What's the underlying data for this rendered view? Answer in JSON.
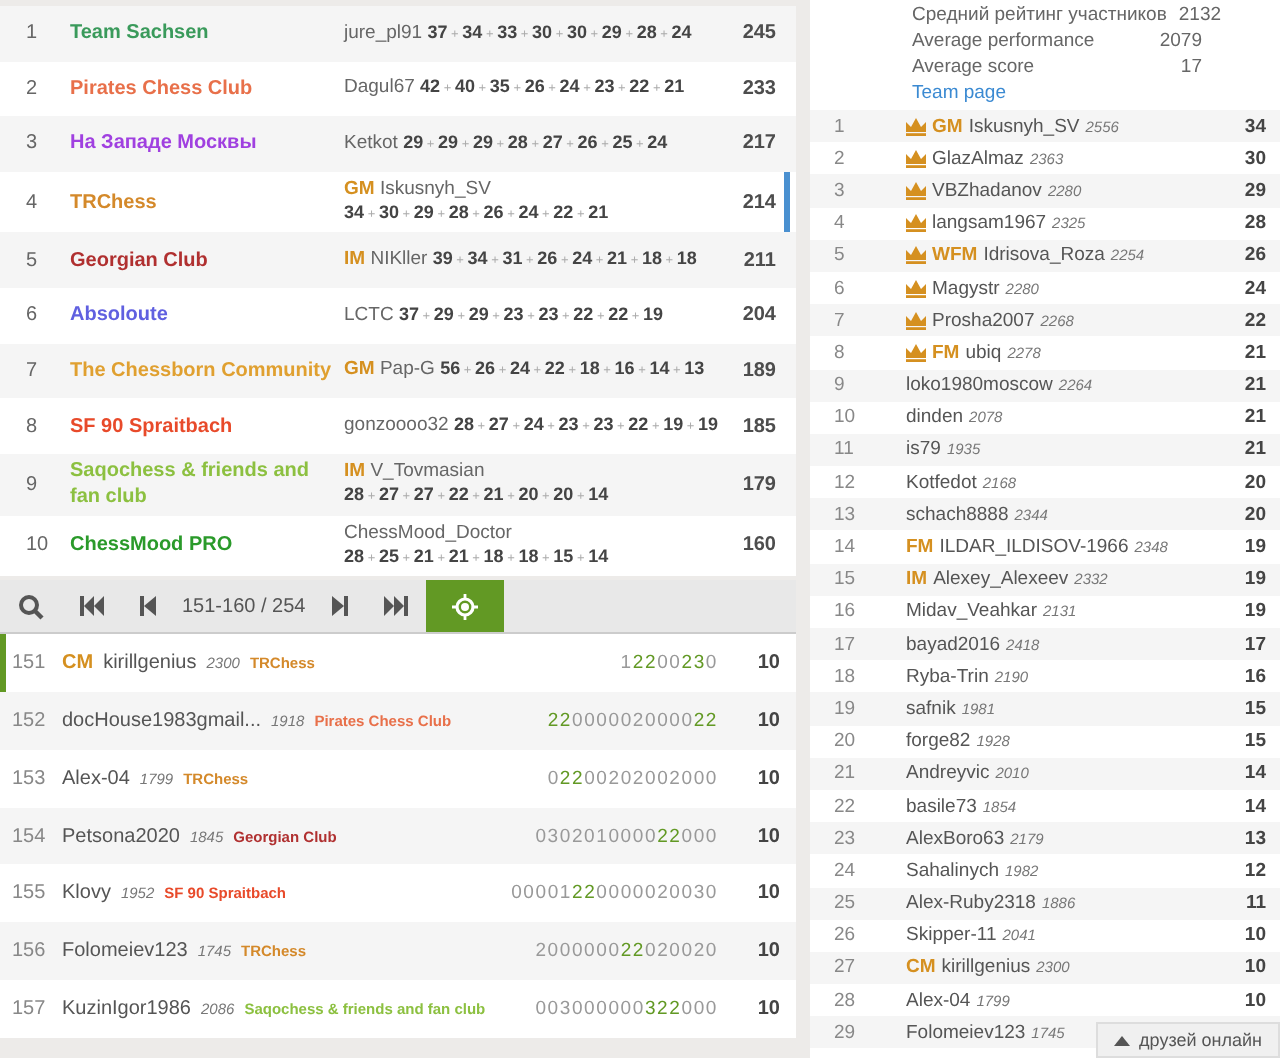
{
  "teams": [
    {
      "rank": "1",
      "name": "Team Sachsen",
      "color": "#3a9a5b",
      "leader": "jure_pl91",
      "points": "**37** + **34** + **33** + **30** + **30** + **29** + **28** + **24**",
      "score": "245",
      "selected": false
    },
    {
      "rank": "2",
      "name": "Pirates Chess Club",
      "color": "#e8704a",
      "leader": "Dagul67",
      "points": "**42** + **40** + **35** + **26** + **24** + **23** + **22** + **21**",
      "score": "233",
      "selected": false
    },
    {
      "rank": "3",
      "name": "На Западе Москвы",
      "color": "#a040e0",
      "leader": "Ketkot",
      "points": "**29** + **29** + **29** + **28** + **27** + **26** + **25** + **24**",
      "score": "217",
      "selected": false
    },
    {
      "rank": "4",
      "name": "TRChess",
      "color": "#d4892a",
      "leader_title": "GM",
      "leader": "Iskusnyh_SV",
      "points": "**34** + **30** + **29** + **28** + **26** + **24** + **22** + **21**",
      "score": "214",
      "selected": true
    },
    {
      "rank": "5",
      "name": "Georgian Club",
      "color": "#b03030",
      "leader_title": "IM",
      "leader": "NIKller",
      "points": "**39** + **34** + **31** + **26** + **24** + **21** + **18** + **18**",
      "score": "211",
      "selected": false
    },
    {
      "rank": "6",
      "name": "Absoloute",
      "color": "#6060e0",
      "leader": "LCTC",
      "points": "**37** + **29** + **29** + **23** + **23** + **22** + **22** + **19**",
      "score": "204",
      "selected": false
    },
    {
      "rank": "7",
      "name": "The Chessborn Community",
      "color": "#e0a030",
      "leader_title": "GM",
      "leader": "Pap-G",
      "points": "**56** + **26** + **24** + **22** + **18** + **16** + **14** + **13**",
      "score": "189",
      "selected": false
    },
    {
      "rank": "8",
      "name": "SF 90 Spraitbach",
      "color": "#e84a2a",
      "leader": "gonzoooo32",
      "points": "**28** + **27** + **24** + **23** + **23** + **22** + **19** + **19**",
      "score": "185",
      "selected": false
    },
    {
      "rank": "9",
      "name": "Saqochess & friends and fan club",
      "color": "#8cc040",
      "leader_title": "IM",
      "leader": "V_Tovmasian",
      "points": "**28** + **27** + **27** + **22** + **21** + **20** + **20** + **14**",
      "score": "179",
      "selected": false
    },
    {
      "rank": "10",
      "name": "ChessMood PRO",
      "color": "#2a9a2a",
      "leader": "ChessMood_Doctor",
      "points": "**28** + **25** + **21** + **21** + **18** + **18** + **15** + **14**",
      "score": "160",
      "selected": false
    }
  ],
  "pager": {
    "range": "151-160 / 254",
    "me_button_on": true
  },
  "players": [
    {
      "rank": "151",
      "title": "CM",
      "name": "kirillgenius",
      "rating": "2300",
      "team": "TRChess",
      "color": "#d4892a",
      "sheet": [
        {
          "text": "1",
          "streak": false
        },
        {
          "text": "22",
          "streak": true
        },
        {
          "text": "00",
          "streak": false
        },
        {
          "text": "23",
          "streak": true
        },
        {
          "text": "0",
          "streak": false
        }
      ],
      "score": "10",
      "selected": true
    },
    {
      "rank": "152",
      "name": "docHouse1983gmail...",
      "rating": "1918",
      "team": "Pirates Chess Club",
      "color": "#e8704a",
      "sheet": [
        {
          "text": "22",
          "streak": true
        },
        {
          "text": "0000020000",
          "streak": false
        },
        {
          "text": "22",
          "streak": true
        }
      ],
      "score": "10",
      "selected": false
    },
    {
      "rank": "153",
      "name": "Alex-04",
      "rating": "1799",
      "team": "TRChess",
      "color": "#d4892a",
      "sheet": [
        {
          "text": "0",
          "streak": false
        },
        {
          "text": "22",
          "streak": true
        },
        {
          "text": "00202002000",
          "streak": false
        }
      ],
      "score": "10",
      "selected": false
    },
    {
      "rank": "154",
      "name": "Petsona2020",
      "rating": "1845",
      "team": "Georgian Club",
      "color": "#b03030",
      "sheet": [
        {
          "text": "0302010000",
          "streak": false
        },
        {
          "text": "22",
          "streak": true
        },
        {
          "text": "000",
          "streak": false
        }
      ],
      "score": "10",
      "selected": false
    },
    {
      "rank": "155",
      "name": "Klovy",
      "rating": "1952",
      "team": "SF 90 Spraitbach",
      "color": "#e84a2a",
      "sheet": [
        {
          "text": "00001",
          "streak": false
        },
        {
          "text": "22",
          "streak": true
        },
        {
          "text": "0000020030",
          "streak": false
        }
      ],
      "score": "10",
      "selected": false
    },
    {
      "rank": "156",
      "name": "Folomeiev123",
      "rating": "1745",
      "team": "TRChess",
      "color": "#d4892a",
      "sheet": [
        {
          "text": "2000000",
          "streak": false
        },
        {
          "text": "22",
          "streak": true
        },
        {
          "text": "020020",
          "streak": false
        }
      ],
      "score": "10",
      "selected": false
    },
    {
      "rank": "157",
      "name": "KuzinIgor1986",
      "rating": "2086",
      "team": "Saqochess & friends and fan club",
      "color": "#8cc040",
      "sheet": [
        {
          "text": "003000000",
          "streak": false
        },
        {
          "text": "322",
          "streak": true
        },
        {
          "text": "000",
          "streak": false
        }
      ],
      "score": "10",
      "selected": false
    }
  ],
  "team_info": {
    "stats": [
      {
        "label": "Средний рейтинг участников",
        "value": "2132"
      },
      {
        "label": "Average performance",
        "value": "2079"
      },
      {
        "label": "Average score",
        "value": "17"
      }
    ],
    "link": "Team page"
  },
  "members": [
    {
      "rank": "1",
      "crown": true,
      "title": "GM",
      "name": "Iskusnyh_SV",
      "rating": "2556",
      "score": "34"
    },
    {
      "rank": "2",
      "crown": true,
      "name": "GlazAlmaz",
      "rating": "2363",
      "score": "30"
    },
    {
      "rank": "3",
      "crown": true,
      "name": "VBZhadanov",
      "rating": "2280",
      "score": "29"
    },
    {
      "rank": "4",
      "crown": true,
      "name": "langsam1967",
      "rating": "2325",
      "score": "28"
    },
    {
      "rank": "5",
      "crown": true,
      "title": "WFM",
      "name": "Idrisova_Roza",
      "rating": "2254",
      "score": "26"
    },
    {
      "rank": "6",
      "crown": true,
      "name": "Magystr",
      "rating": "2280",
      "score": "24"
    },
    {
      "rank": "7",
      "crown": true,
      "name": "Prosha2007",
      "rating": "2268",
      "score": "22"
    },
    {
      "rank": "8",
      "crown": true,
      "title": "FM",
      "name": "ubiq",
      "rating": "2278",
      "score": "21"
    },
    {
      "rank": "9",
      "crown": false,
      "name": "loko1980moscow",
      "rating": "2264",
      "score": "21"
    },
    {
      "rank": "10",
      "crown": false,
      "name": "dinden",
      "rating": "2078",
      "score": "21"
    },
    {
      "rank": "11",
      "crown": false,
      "name": "is79",
      "rating": "1935",
      "score": "21"
    },
    {
      "rank": "12",
      "crown": false,
      "name": "Kotfedot",
      "rating": "2168",
      "score": "20"
    },
    {
      "rank": "13",
      "crown": false,
      "name": "schach8888",
      "rating": "2344",
      "score": "20"
    },
    {
      "rank": "14",
      "crown": false,
      "title": "FM",
      "name": "ILDAR_ILDISOV-1966",
      "rating": "2348",
      "score": "19"
    },
    {
      "rank": "15",
      "crown": false,
      "title": "IM",
      "name": "Alexey_Alexeev",
      "rating": "2332",
      "score": "19"
    },
    {
      "rank": "16",
      "crown": false,
      "name": "Midav_Veahkar",
      "rating": "2131",
      "score": "19"
    },
    {
      "rank": "17",
      "crown": false,
      "name": "bayad2016",
      "rating": "2418",
      "score": "17"
    },
    {
      "rank": "18",
      "crown": false,
      "name": "Ryba-Trin",
      "rating": "2190",
      "score": "16"
    },
    {
      "rank": "19",
      "crown": false,
      "name": "safnik",
      "rating": "1981",
      "score": "15"
    },
    {
      "rank": "20",
      "crown": false,
      "name": "forge82",
      "rating": "1928",
      "score": "15"
    },
    {
      "rank": "21",
      "crown": false,
      "name": "Andreyvic",
      "rating": "2010",
      "score": "14"
    },
    {
      "rank": "22",
      "crown": false,
      "name": "basile73",
      "rating": "1854",
      "score": "14"
    },
    {
      "rank": "23",
      "crown": false,
      "name": "AlexBoro63",
      "rating": "2179",
      "score": "13"
    },
    {
      "rank": "24",
      "crown": false,
      "name": "Sahalinych",
      "rating": "1982",
      "score": "12"
    },
    {
      "rank": "25",
      "crown": false,
      "name": "Alex-Ruby2318",
      "rating": "1886",
      "score": "11"
    },
    {
      "rank": "26",
      "crown": false,
      "name": "Skipper-11",
      "rating": "2041",
      "score": "10"
    },
    {
      "rank": "27",
      "crown": false,
      "title": "CM",
      "name": "kirillgenius",
      "rating": "2300",
      "score": "10"
    },
    {
      "rank": "28",
      "crown": false,
      "name": "Alex-04",
      "rating": "1799",
      "score": "10"
    },
    {
      "rank": "29",
      "crown": false,
      "name": "Folomeiev123",
      "rating": "1745"
    }
  ],
  "friends_button": "друзей онлайн"
}
